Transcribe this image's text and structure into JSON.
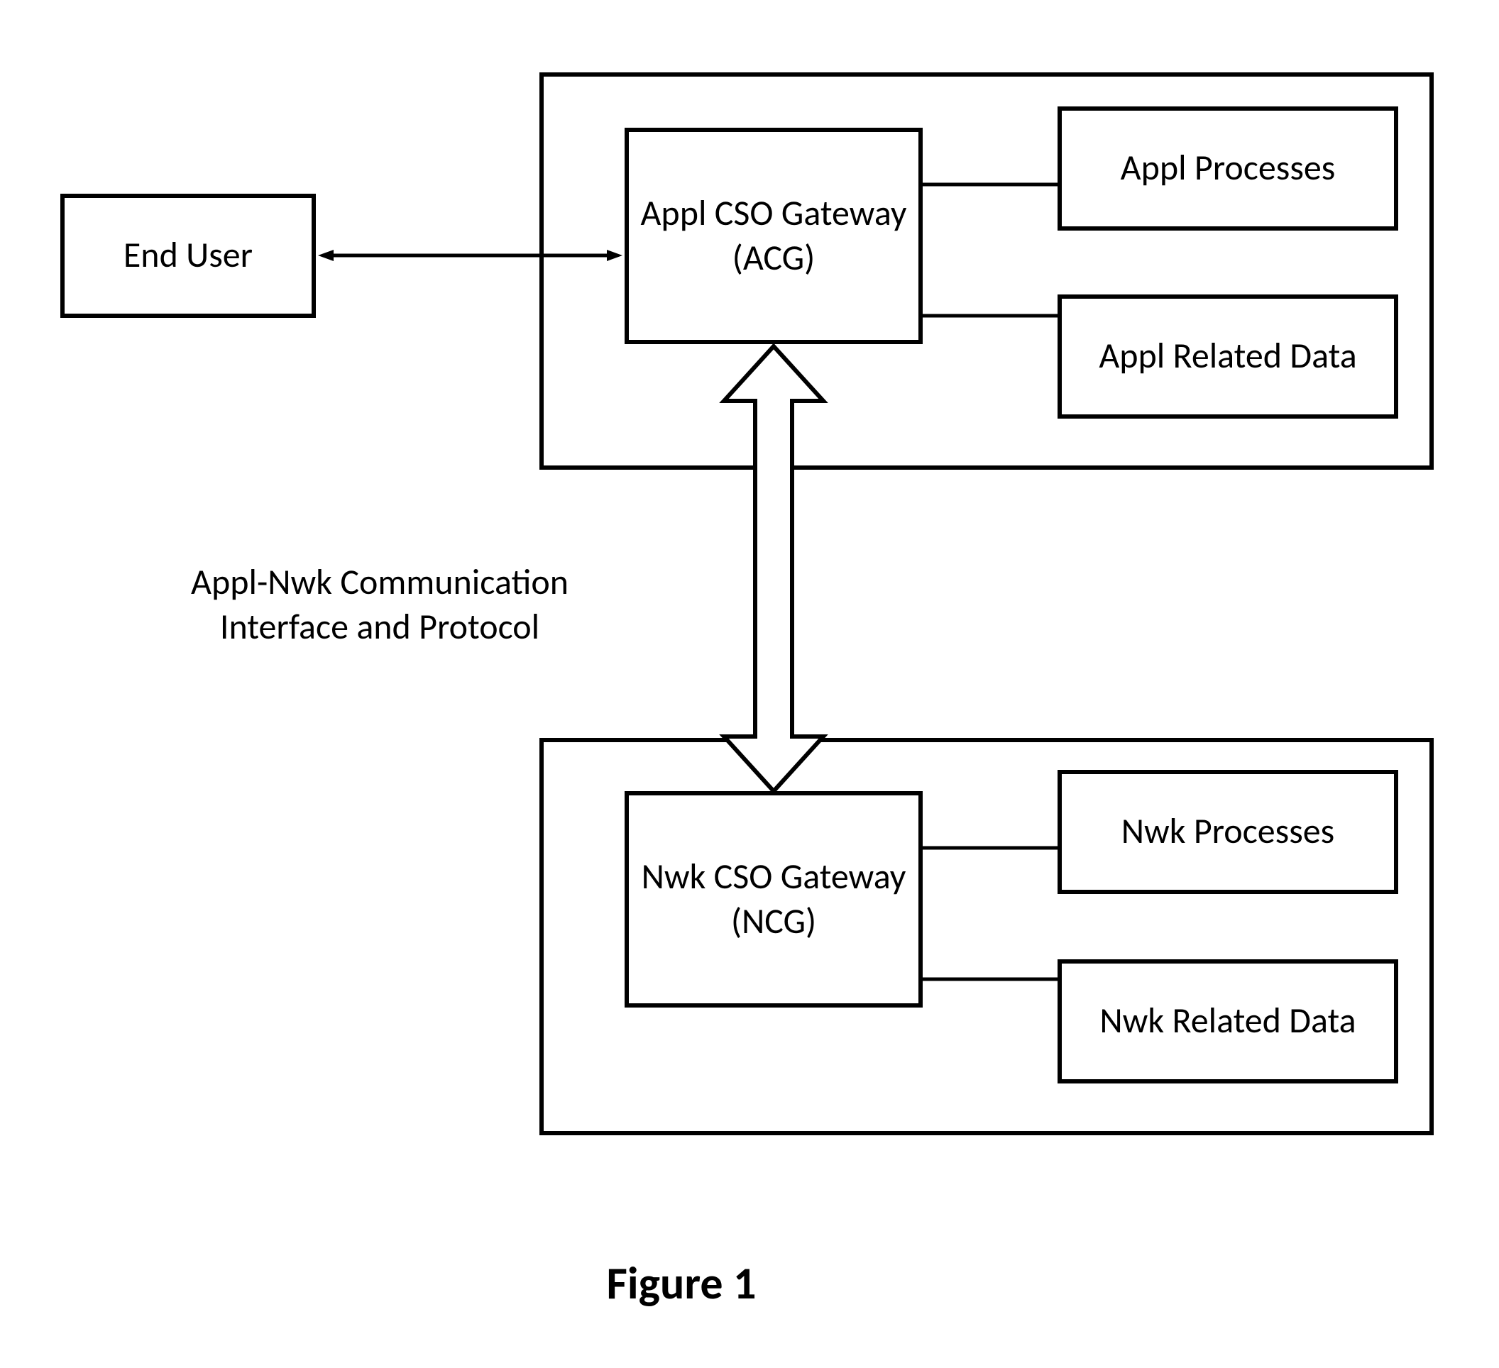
{
  "boxes": {
    "end_user": "End User",
    "acg": "Appl CSO Gateway (ACG)",
    "appl_processes": "Appl Processes",
    "appl_related_data": "Appl Related Data",
    "ncg": "Nwk CSO Gateway (NCG)",
    "nwk_processes": "Nwk Processes",
    "nwk_related_data": "Nwk Related Data"
  },
  "labels": {
    "interface_line1": "Appl-Nwk Communication",
    "interface_line2": "Interface and Protocol"
  },
  "caption": "Figure 1"
}
